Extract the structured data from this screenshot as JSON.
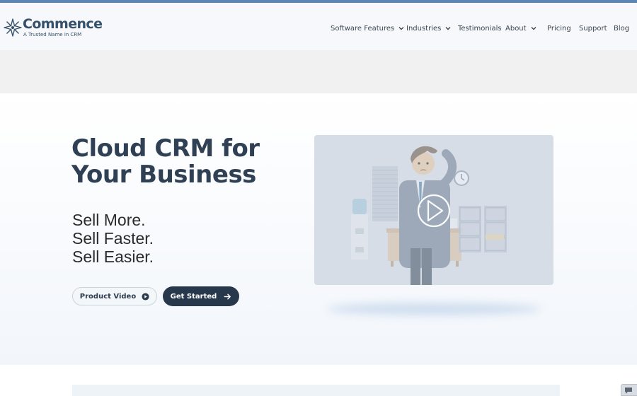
{
  "brand": {
    "name": "Commence",
    "tagline": "A Trusted Name in CRM",
    "color": "#34506a"
  },
  "nav": {
    "items": [
      {
        "label": "Software Features",
        "dropdown": true
      },
      {
        "label": "Industries",
        "dropdown": true
      },
      {
        "label": "Testimonials",
        "dropdown": false
      },
      {
        "label": "About",
        "dropdown": true
      },
      {
        "label": "Pricing",
        "dropdown": false
      },
      {
        "label": "Support",
        "dropdown": false
      },
      {
        "label": "Blog",
        "dropdown": false
      }
    ]
  },
  "hero": {
    "title_line1": "Cloud CRM for",
    "title_line2": "Your Business",
    "taglines": [
      "Sell More.",
      "Sell Faster.",
      "Sell Easier."
    ],
    "video_button": {
      "label": "Product Video",
      "icon": "play-circle-icon"
    },
    "start_button": {
      "label": "Get Started",
      "icon": "arrow-right-icon"
    }
  },
  "video": {
    "icon": "play-icon",
    "illustration": "office-worker"
  },
  "colors": {
    "accent_bar": "#5b86b3",
    "dark_button": "#27384d",
    "heading": "#2f4055"
  },
  "chat_widget": {
    "icon": "chat-icon"
  }
}
